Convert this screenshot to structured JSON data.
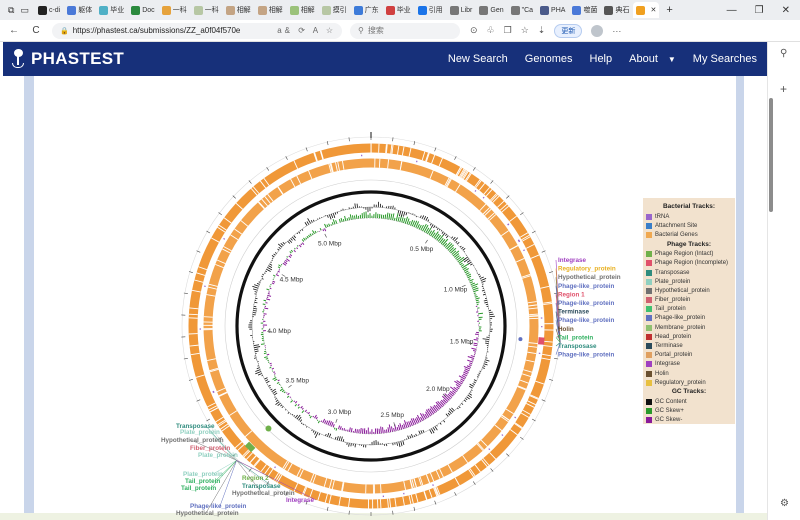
{
  "browser": {
    "tabs": [
      {
        "label": "c-di",
        "color": "#222222"
      },
      {
        "label": "躯体",
        "color": "#4a79d8"
      },
      {
        "label": "毕业",
        "color": "#4fb0c6"
      },
      {
        "label": "Doc",
        "color": "#2b8a3e"
      },
      {
        "label": "一科",
        "color": "#e6a23c"
      },
      {
        "label": "一科",
        "color": "#b7c7a4"
      },
      {
        "label": "相解",
        "color": "#c4a484"
      },
      {
        "label": "相解",
        "color": "#c4a484"
      },
      {
        "label": "相解",
        "color": "#9bc27a"
      },
      {
        "label": "摸引",
        "color": "#b7c7a4"
      },
      {
        "label": "广东",
        "color": "#3d7bd9"
      },
      {
        "label": "毕业",
        "color": "#d04040"
      },
      {
        "label": "引用",
        "color": "#1a73e8"
      },
      {
        "label": "Libr",
        "color": "#777777"
      },
      {
        "label": "Gen",
        "color": "#777777"
      },
      {
        "label": "\"Ca",
        "color": "#777777"
      },
      {
        "label": "PHA",
        "color": "#4a5a8a"
      },
      {
        "label": "噬菌",
        "color": "#4a79d8"
      },
      {
        "label": "典石",
        "color": "#555555"
      },
      {
        "label": "",
        "color": "#f0a020"
      }
    ],
    "active_tab_close": "✕",
    "new_tab": "+",
    "window_controls": [
      "—",
      "❐",
      "✕"
    ],
    "back": "←",
    "reload": "C",
    "lock": "🔒",
    "url": "https://phastest.ca/submissions/ZZ_a0f04f570e",
    "url_extras": "a&  ⟳  A  ☆",
    "search_placeholder": "搜索",
    "update_label": "更新",
    "tool_icons": [
      "⊙",
      "♧",
      "❐",
      "☆",
      "⇣"
    ],
    "more": "···"
  },
  "site": {
    "logo_text": "PHASTEST",
    "nav": {
      "new_search": "New Search",
      "genomes": "Genomes",
      "help": "Help",
      "about": "About",
      "about_caret": "▼",
      "my_searches": "My Searches"
    }
  },
  "sidebar_icons": {
    "search": "⚲",
    "add": "+",
    "settings": "⚙"
  },
  "legend": {
    "bacterial_title": "Bacterial Tracks:",
    "bacterial": [
      {
        "label": "tRNA",
        "color": "#9966cc"
      },
      {
        "label": "Attachment Site",
        "color": "#3a7ec8"
      },
      {
        "label": "Bacterial Genes",
        "color": "#f0a850"
      }
    ],
    "phage_title": "Phage Tracks:",
    "phage": [
      {
        "label": "Phage Region (Intact)",
        "color": "#6fb04a"
      },
      {
        "label": "Phage Region (Incomplete)",
        "color": "#e0506a"
      },
      {
        "label": "Transposase",
        "color": "#2f8c7e"
      },
      {
        "label": "Plate_protein",
        "color": "#90d0c0"
      },
      {
        "label": "Hypothetical_protein",
        "color": "#707070"
      },
      {
        "label": "Fiber_protein",
        "color": "#d06070"
      },
      {
        "label": "Tail_protein",
        "color": "#40c070"
      },
      {
        "label": "Phage-like_protein",
        "color": "#6070c0"
      },
      {
        "label": "Membrane_protein",
        "color": "#90c070"
      },
      {
        "label": "Head_protein",
        "color": "#c03030"
      },
      {
        "label": "Terminase",
        "color": "#2a4a5a"
      },
      {
        "label": "Portal_protein",
        "color": "#e0a060"
      },
      {
        "label": "Integrase",
        "color": "#a040c0"
      },
      {
        "label": "Holin",
        "color": "#6a5030"
      },
      {
        "label": "Regulatory_protein",
        "color": "#e8c040"
      }
    ],
    "gc_title": "GC Tracks:",
    "gc": [
      {
        "label": "GC Content",
        "color": "#111111"
      },
      {
        "label": "GC Skew+",
        "color": "#2a9a2a"
      },
      {
        "label": "GC Skew-",
        "color": "#8a1a9a"
      }
    ]
  },
  "genome_map": {
    "tick_labels": [
      {
        "label": "0.5 Mbp",
        "mbp": 0.5
      },
      {
        "label": "1.0 Mbp",
        "mbp": 1.0
      },
      {
        "label": "1.5 Mbp",
        "mbp": 1.5
      },
      {
        "label": "2.0 Mbp",
        "mbp": 2.0
      },
      {
        "label": "2.5 Mbp",
        "mbp": 2.5
      },
      {
        "label": "3.0 Mbp",
        "mbp": 3.0
      },
      {
        "label": "3.5 Mbp",
        "mbp": 3.5
      },
      {
        "label": "4.0 Mbp",
        "mbp": 4.0
      },
      {
        "label": "4.5 Mbp",
        "mbp": 4.5
      },
      {
        "label": "5.0 Mbp",
        "mbp": 5.0
      }
    ],
    "total_mbp": 5.4,
    "region1": {
      "labels": [
        {
          "text": "Integrase",
          "color": "#a040c0"
        },
        {
          "text": "Regulatory_protein",
          "color": "#e8b020"
        },
        {
          "text": "Hypothetical_protein",
          "color": "#707070"
        },
        {
          "text": "Phage-like_protein",
          "color": "#6070c0"
        },
        {
          "text": "Region 1",
          "color": "#e0506a"
        },
        {
          "text": "Phage-like_protein",
          "color": "#6070c0"
        },
        {
          "text": "Terminase",
          "color": "#2a4a5a"
        },
        {
          "text": "Phage-like_protein",
          "color": "#6070c0"
        },
        {
          "text": "Holin",
          "color": "#6a5030"
        },
        {
          "text": "Tail_protein",
          "color": "#30b060"
        },
        {
          "text": "Transposase",
          "color": "#2f8c7e"
        },
        {
          "text": "Phage-like_protein",
          "color": "#6070c0"
        }
      ]
    },
    "region2": {
      "labels": [
        {
          "text": "Transposase",
          "color": "#2f8c7e"
        },
        {
          "text": "Plate_protein",
          "color": "#90d0c0"
        },
        {
          "text": "Hypothetical_protein",
          "color": "#707070"
        },
        {
          "text": "Fiber_protein",
          "color": "#d06070"
        },
        {
          "text": "Plate_protein",
          "color": "#90d0c0"
        },
        {
          "text": "Plate_protein",
          "color": "#90d0c0"
        },
        {
          "text": "Tail_protein",
          "color": "#30b060"
        },
        {
          "text": "Tail_protein",
          "color": "#30b060"
        },
        {
          "text": "Region 2",
          "color": "#6fb04a"
        },
        {
          "text": "Transposase",
          "color": "#2f8c7e"
        },
        {
          "text": "Hypothetical_protein",
          "color": "#707070"
        },
        {
          "text": "Integrase",
          "color": "#a040c0"
        },
        {
          "text": "Phage-like_protein",
          "color": "#6070c0"
        },
        {
          "text": "Hypothetical_protein",
          "color": "#707070"
        }
      ]
    }
  }
}
